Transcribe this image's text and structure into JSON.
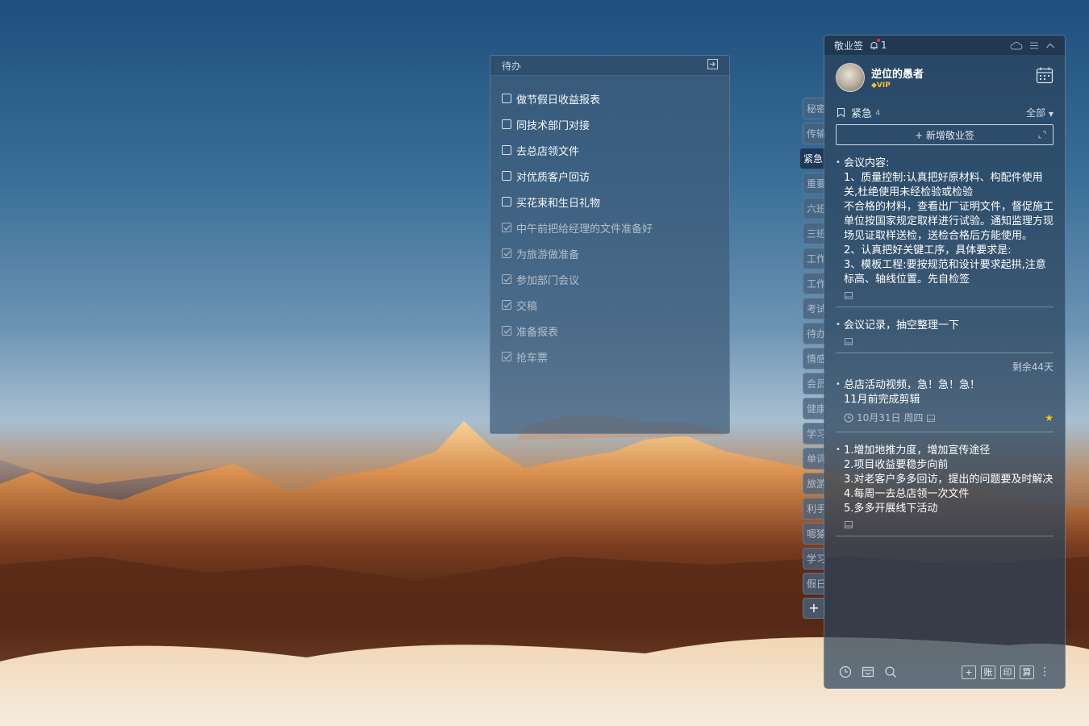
{
  "todo": {
    "title": "待办",
    "items": [
      {
        "text": "做节假日收益报表",
        "done": false
      },
      {
        "text": "同技术部门对接",
        "done": false
      },
      {
        "text": "去总店领文件",
        "done": false
      },
      {
        "text": "对优质客户回访",
        "done": false
      },
      {
        "text": "买花束和生日礼物",
        "done": false
      },
      {
        "text": "中午前把给经理的文件准备好",
        "done": true
      },
      {
        "text": "为旅游做准备",
        "done": true
      },
      {
        "text": "参加部门会议",
        "done": true
      },
      {
        "text": "交稿",
        "done": true
      },
      {
        "text": "准备报表",
        "done": true
      },
      {
        "text": "抢车票",
        "done": true
      }
    ]
  },
  "tabs": {
    "items": [
      "秘密",
      "传输",
      "紧急",
      "重要",
      "六班",
      "三班",
      "工作",
      "工作",
      "考试",
      "待办",
      "情感",
      "会员",
      "健康",
      "学习",
      "单词",
      "旅游",
      "利手",
      "嗯猿",
      "学习",
      "假日"
    ],
    "active_index": 2,
    "add_label": "+"
  },
  "panel": {
    "app_name": "敬业签",
    "notification_count": "1",
    "user": {
      "name": "逆位的愚者",
      "badge": "VIP"
    },
    "category": {
      "name": "紧急",
      "count": "4"
    },
    "filter": "全部",
    "add_note_label": "+ 新增敬业签",
    "notes": [
      {
        "body": "会议内容:\n1、质量控制:认真把好原材料、构配件使用关,杜绝使用未经检验或检验\n不合格的材料，查看出厂证明文件，督促施工单位按国家规定取样进行试验。通知监理方现场见证取样送检，送检合格后方能使用。\n2、认真把好关键工序，具体要求是:\n3、模板工程:要按规范和设计要求起拱,注意标高、轴线位置。先自检签",
        "max_height": 180
      },
      {
        "body": "会议记录，抽空整理一下"
      },
      {
        "remaining": "剩余44天",
        "body": "总店活动视频，急！急！急！\n11月前完成剪辑",
        "reminder": "10月31日 周四",
        "starred": true
      },
      {
        "body": "1.增加地推力度，增加宣传途径\n2.项目收益要稳步向前\n3.对老客户多多回访，提出的问题要及时解决\n4.每周一去总店领一次文件\n5.多多开展线下活动"
      }
    ],
    "bottom_buttons": [
      "+",
      "账",
      "印",
      "算"
    ]
  },
  "colors": {
    "star": "#f5c518",
    "vip": "#f2c232",
    "notify_dot": "#e43c3c"
  }
}
